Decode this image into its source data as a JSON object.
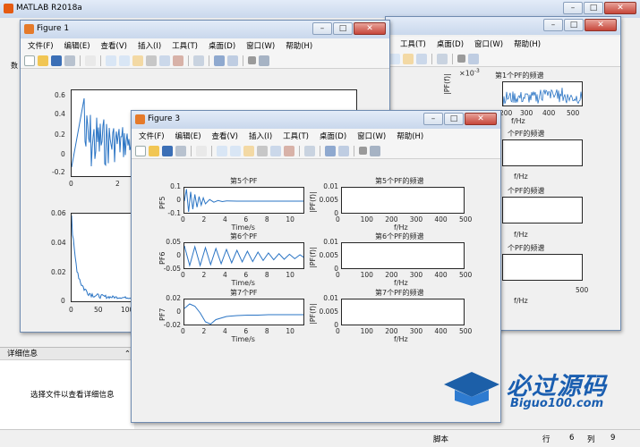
{
  "matlab": {
    "title": "MATLAB R2018a",
    "toolstrip_frag": "数",
    "detail_header": "详细信息",
    "detail_text": "选择文件以查看详细信息",
    "status": {
      "script_label": "脚本",
      "row_label": "行",
      "row_value": "6",
      "col_label": "列",
      "col_value": "9"
    }
  },
  "fig1": {
    "title": "Figure 1",
    "menu": [
      "文件(F)",
      "编辑(E)",
      "查看(V)",
      "插入(I)",
      "工具(T)",
      "桌面(D)",
      "窗口(W)",
      "帮助(H)"
    ],
    "top_yticks": [
      "0.6",
      "0.4",
      "0.2",
      "0",
      "-0.2"
    ],
    "top_xticks": [
      "0",
      "2"
    ],
    "bot_yticks": [
      "0.06",
      "0.04",
      "0.02",
      "0"
    ],
    "bot_xticks": [
      "0",
      "50",
      "100"
    ]
  },
  "fig2": {
    "menu": [
      "工具(T)",
      "桌面(D)",
      "窗口(W)",
      "帮助(H)"
    ],
    "exp": "×10",
    "exp_sup": "-3",
    "spec_title_1": "第1个PF的频谱",
    "ylabel": "|PF(f)|",
    "xticks": [
      "200",
      "300",
      "400",
      "500"
    ],
    "xlabel": "f/Hz",
    "title_frag": "个PF的频谱"
  },
  "fig3": {
    "title": "Figure 3",
    "menu": [
      "文件(F)",
      "编辑(E)",
      "查看(V)",
      "插入(I)",
      "工具(T)",
      "桌面(D)",
      "窗口(W)",
      "帮助(H)"
    ],
    "left": [
      {
        "title": "第5个PF",
        "ylabel": "PF5",
        "yticks": [
          "0.1",
          "0",
          "-0.1"
        ]
      },
      {
        "title": "第6个PF",
        "ylabel": "PF6",
        "yticks": [
          "0.05",
          "0",
          "-0.05"
        ]
      },
      {
        "title": "第7个PF",
        "ylabel": "PF7",
        "yticks": [
          "0.02",
          "0",
          "-0.02"
        ]
      }
    ],
    "right": [
      {
        "title": "第5个PF的频谱",
        "ylabel": "|PF(f)|",
        "yticks": [
          "0.01",
          "0.005",
          "0"
        ]
      },
      {
        "title": "第6个PF的频谱",
        "ylabel": "|PF(f)|",
        "yticks": [
          "0.01",
          "0.005",
          "0"
        ]
      },
      {
        "title": "第7个PF的频谱",
        "ylabel": "|PF(f)|",
        "yticks": [
          "0.01",
          "0.005",
          "0"
        ]
      }
    ],
    "time_xticks": [
      "0",
      "2",
      "4",
      "6",
      "8",
      "10"
    ],
    "time_xlabel": "Time/s",
    "freq_xticks": [
      "0",
      "100",
      "200",
      "300",
      "400",
      "500"
    ],
    "freq_xlabel": "f/Hz"
  },
  "watermark": {
    "cn": "必过源码",
    "en": "Biguo100.com"
  },
  "colors": {
    "line": "#2a74c4",
    "axes_bg": "#ffffff",
    "window_bg": "#f0f0f0"
  },
  "chart_data": [
    {
      "type": "line",
      "title": "第5个PF",
      "xlabel": "Time/s",
      "ylabel": "PF5",
      "xlim": [
        0,
        11.5
      ],
      "ylim": [
        -0.1,
        0.1
      ],
      "x": [
        0,
        0.2,
        0.4,
        0.6,
        0.8,
        1.0,
        1.2,
        1.4,
        1.6,
        1.8,
        2.0,
        2.4,
        2.8,
        3.2,
        3.6,
        4.0,
        5,
        6,
        8,
        10,
        11.5
      ],
      "y": [
        0,
        0.09,
        -0.08,
        0.07,
        -0.06,
        0.05,
        -0.045,
        0.035,
        -0.03,
        0.025,
        -0.02,
        0.012,
        -0.008,
        0.005,
        -0.003,
        0.002,
        0.0,
        0.0,
        0.0,
        0.0,
        0.0
      ]
    },
    {
      "type": "line",
      "title": "第6个PF",
      "xlabel": "Time/s",
      "ylabel": "PF6",
      "xlim": [
        0,
        11.5
      ],
      "ylim": [
        -0.075,
        0.075
      ],
      "x": [
        0,
        0.5,
        1.0,
        1.5,
        2.0,
        2.5,
        3.0,
        3.5,
        4.0,
        4.5,
        5.0,
        5.5,
        6.0,
        6.5,
        7.0,
        7.5,
        8.0,
        8.5,
        9.0,
        9.5,
        10.0,
        10.5,
        11.0,
        11.5
      ],
      "y": [
        0.06,
        -0.05,
        0.055,
        -0.05,
        0.05,
        -0.045,
        0.045,
        -0.04,
        0.04,
        -0.035,
        0.035,
        -0.03,
        0.03,
        -0.028,
        0.025,
        -0.022,
        0.02,
        -0.018,
        0.016,
        -0.015,
        0.013,
        -0.012,
        0.01,
        -0.01
      ]
    },
    {
      "type": "line",
      "title": "第7个PF",
      "xlabel": "Time/s",
      "ylabel": "PF7",
      "xlim": [
        0,
        11.5
      ],
      "ylim": [
        -0.03,
        0.03
      ],
      "x": [
        0,
        0.5,
        1.0,
        1.5,
        2.0,
        2.5,
        3.0,
        4.0,
        5.0,
        6.0,
        7.0,
        8.0,
        9.0,
        10.0,
        11.0,
        11.5
      ],
      "y": [
        0.01,
        0.02,
        0.015,
        0.0,
        -0.02,
        -0.025,
        -0.015,
        -0.008,
        -0.006,
        -0.005,
        -0.005,
        -0.004,
        -0.004,
        -0.004,
        -0.004,
        -0.004
      ]
    },
    {
      "type": "line",
      "title": "第5个PF的频谱",
      "xlabel": "f/Hz",
      "ylabel": "|PF(f)|",
      "xlim": [
        0,
        500
      ],
      "ylim": [
        0,
        0.01
      ],
      "x": [
        0,
        2,
        4,
        6,
        500
      ],
      "y": [
        0,
        0.0,
        0.0,
        0.0,
        0.0
      ]
    },
    {
      "type": "line",
      "title": "第6个PF的频谱",
      "xlabel": "f/Hz",
      "ylabel": "|PF(f)|",
      "xlim": [
        0,
        500
      ],
      "ylim": [
        0,
        0.01
      ],
      "x": [
        0,
        2,
        4,
        6,
        500
      ],
      "y": [
        0,
        0.0,
        0.0,
        0.0,
        0.0
      ]
    },
    {
      "type": "line",
      "title": "第7个PF的频谱",
      "xlabel": "f/Hz",
      "ylabel": "|PF(f)|",
      "xlim": [
        0,
        500
      ],
      "ylim": [
        0,
        0.01
      ],
      "x": [
        0,
        2,
        4,
        6,
        500
      ],
      "y": [
        0,
        0.0,
        0.0,
        0.0,
        0.0
      ]
    }
  ]
}
